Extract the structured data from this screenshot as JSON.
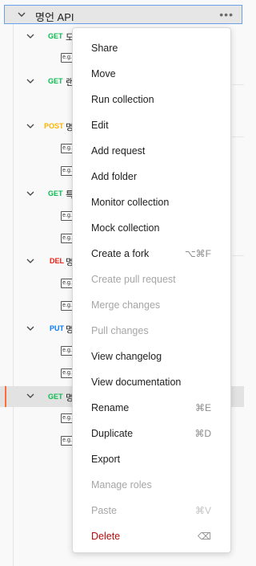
{
  "collection": {
    "name": "명언 API"
  },
  "requests": [
    {
      "method": "GET",
      "name": "도",
      "examples": 1
    },
    {
      "method": "GET",
      "name": "랜",
      "examples": 0
    },
    {
      "method": "POST",
      "name": "명",
      "examples": 2
    },
    {
      "method": "GET",
      "name": "특",
      "examples": 2
    },
    {
      "method": "DEL",
      "name": "명",
      "examples": 2
    },
    {
      "method": "PUT",
      "name": "명",
      "examples": 2
    },
    {
      "method": "GET",
      "name": "명",
      "examples": 2
    }
  ],
  "example_icon_text": "e.g.",
  "context_menu": {
    "items": [
      {
        "label": "Share",
        "shortcut": "",
        "disabled": false
      },
      {
        "label": "Move",
        "shortcut": "",
        "disabled": false
      },
      {
        "label": "Run collection",
        "shortcut": "",
        "disabled": false
      },
      {
        "label": "Edit",
        "shortcut": "",
        "disabled": false
      },
      {
        "label": "Add request",
        "shortcut": "",
        "disabled": false
      },
      {
        "label": "Add folder",
        "shortcut": "",
        "disabled": false
      },
      {
        "label": "Monitor collection",
        "shortcut": "",
        "disabled": false
      },
      {
        "label": "Mock collection",
        "shortcut": "",
        "disabled": false
      },
      {
        "label": "Create a fork",
        "shortcut": "⌥⌘F",
        "disabled": false
      },
      {
        "label": "Create pull request",
        "shortcut": "",
        "disabled": true
      },
      {
        "label": "Merge changes",
        "shortcut": "",
        "disabled": true
      },
      {
        "label": "Pull changes",
        "shortcut": "",
        "disabled": true
      },
      {
        "label": "View changelog",
        "shortcut": "",
        "disabled": false
      },
      {
        "label": "View documentation",
        "shortcut": "",
        "disabled": false
      },
      {
        "label": "Rename",
        "shortcut": "⌘E",
        "disabled": false
      },
      {
        "label": "Duplicate",
        "shortcut": "⌘D",
        "disabled": false
      },
      {
        "label": "Export",
        "shortcut": "",
        "disabled": false
      },
      {
        "label": "Manage roles",
        "shortcut": "",
        "disabled": true
      },
      {
        "label": "Paste",
        "shortcut": "⌘V",
        "disabled": true
      },
      {
        "label": "Delete",
        "shortcut": "⌫",
        "disabled": false
      }
    ]
  },
  "colors": {
    "get": "#0cbb52",
    "post": "#ffb400",
    "delete": "#eb2013",
    "put": "#097bed",
    "danger": "#b00d0d",
    "selected_accent": "#ff6c37"
  }
}
